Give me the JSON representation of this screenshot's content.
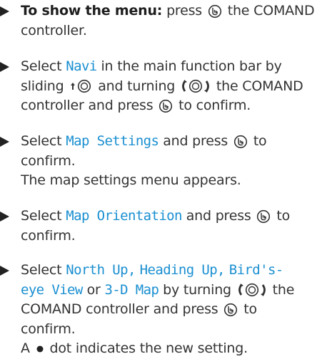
{
  "steps": [
    {
      "show_menu_label": "To show the menu:",
      "press_text": "press",
      "the_controller": "the COMAND",
      "controller_word": "controller."
    },
    {
      "select_text": "Select",
      "item": "Navi",
      "main_bar_text": "in the main function bar by",
      "sliding_text": "sliding",
      "and_turning_text": "and turning",
      "the_comand": "the COMAND",
      "controller_and_press": "controller and press",
      "to_confirm": "to confirm."
    },
    {
      "select_text": "Select",
      "item": "Map Settings",
      "and_press": "and press",
      "to_text": "to",
      "confirm_text": "confirm.",
      "result_text": "The map settings menu appears."
    },
    {
      "select_text": "Select",
      "item": "Map Orientation",
      "and_press": "and press",
      "to_text": "to",
      "confirm_text": "confirm."
    },
    {
      "select_text": "Select",
      "item1": "North Up,",
      "item2": "Heading Up,",
      "item3_part1": "Bird's-",
      "item3_part2": "eye View",
      "or_text": "or",
      "item4": "3-D Map",
      "by_turning": "by turning",
      "the_text": "the",
      "controller_and_press": "COMAND controller and press",
      "to_text": "to",
      "confirm_text": "confirm.",
      "result_prefix": "A",
      "result_suffix": "dot indicates the new setting."
    }
  ],
  "icons": {
    "press": "press-controller-icon",
    "slide_up": "slide-up-controller-icon",
    "turn": "turn-controller-icon",
    "bullet_dot": "selection-dot-icon",
    "step_marker": "step-arrow-icon"
  },
  "colors": {
    "menu_text": "#1a8fd1",
    "body_text": "#333333"
  }
}
